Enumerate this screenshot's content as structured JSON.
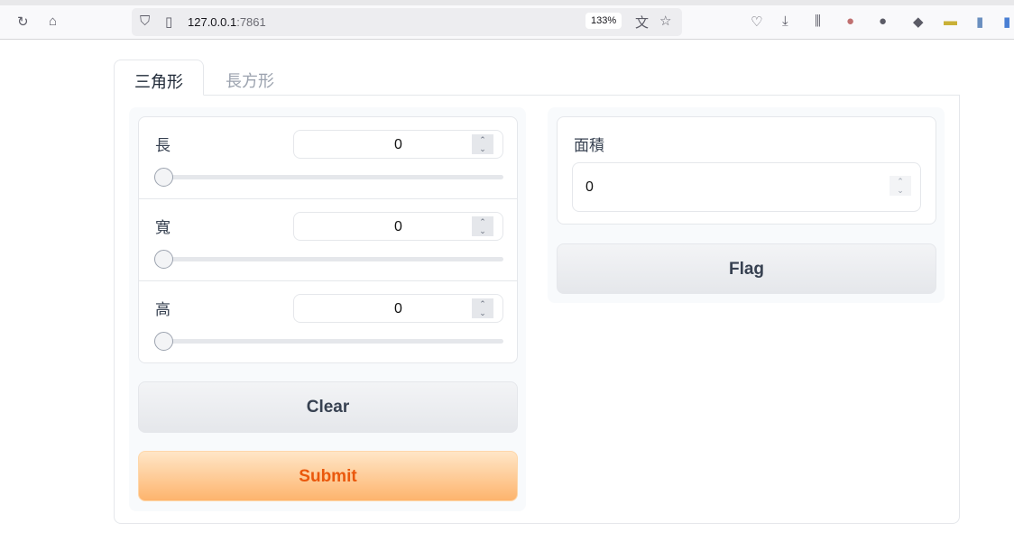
{
  "browser": {
    "url_host": "127.0.0.1",
    "url_port": ":7861",
    "zoom": "133%"
  },
  "tabs": [
    {
      "label": "三角形",
      "active": true
    },
    {
      "label": "長方形",
      "active": false
    }
  ],
  "inputs": [
    {
      "label": "長",
      "value": "0",
      "slider": 0
    },
    {
      "label": "寬",
      "value": "0",
      "slider": 0
    },
    {
      "label": "高",
      "value": "0",
      "slider": 0
    }
  ],
  "output": {
    "label": "面積",
    "value": "0"
  },
  "buttons": {
    "clear": "Clear",
    "submit": "Submit",
    "flag": "Flag"
  },
  "colors": {
    "accent": "#ea580c"
  }
}
